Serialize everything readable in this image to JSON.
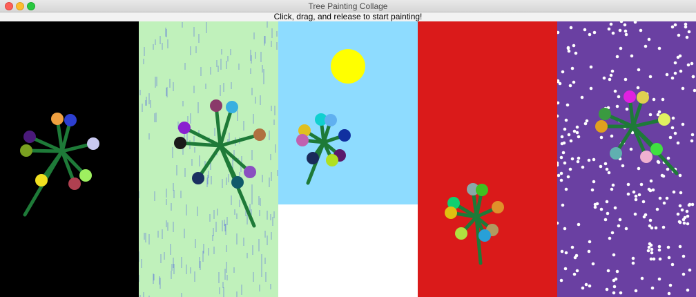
{
  "window": {
    "title": "Tree Painting Collage"
  },
  "instructions": "Click, drag, and release to start painting!",
  "colors": {
    "panel_night": "#000000",
    "panel_rain": "#c0f1bb",
    "panel_sky": "#8edcff",
    "panel_ground": "#ffffff",
    "panel_red": "#da1a1a",
    "panel_purple": "#6a40a2",
    "sun": "#ffff00",
    "branch": "#1e7a38",
    "rain": "#7f9fd0",
    "snow": "#ffffff"
  }
}
